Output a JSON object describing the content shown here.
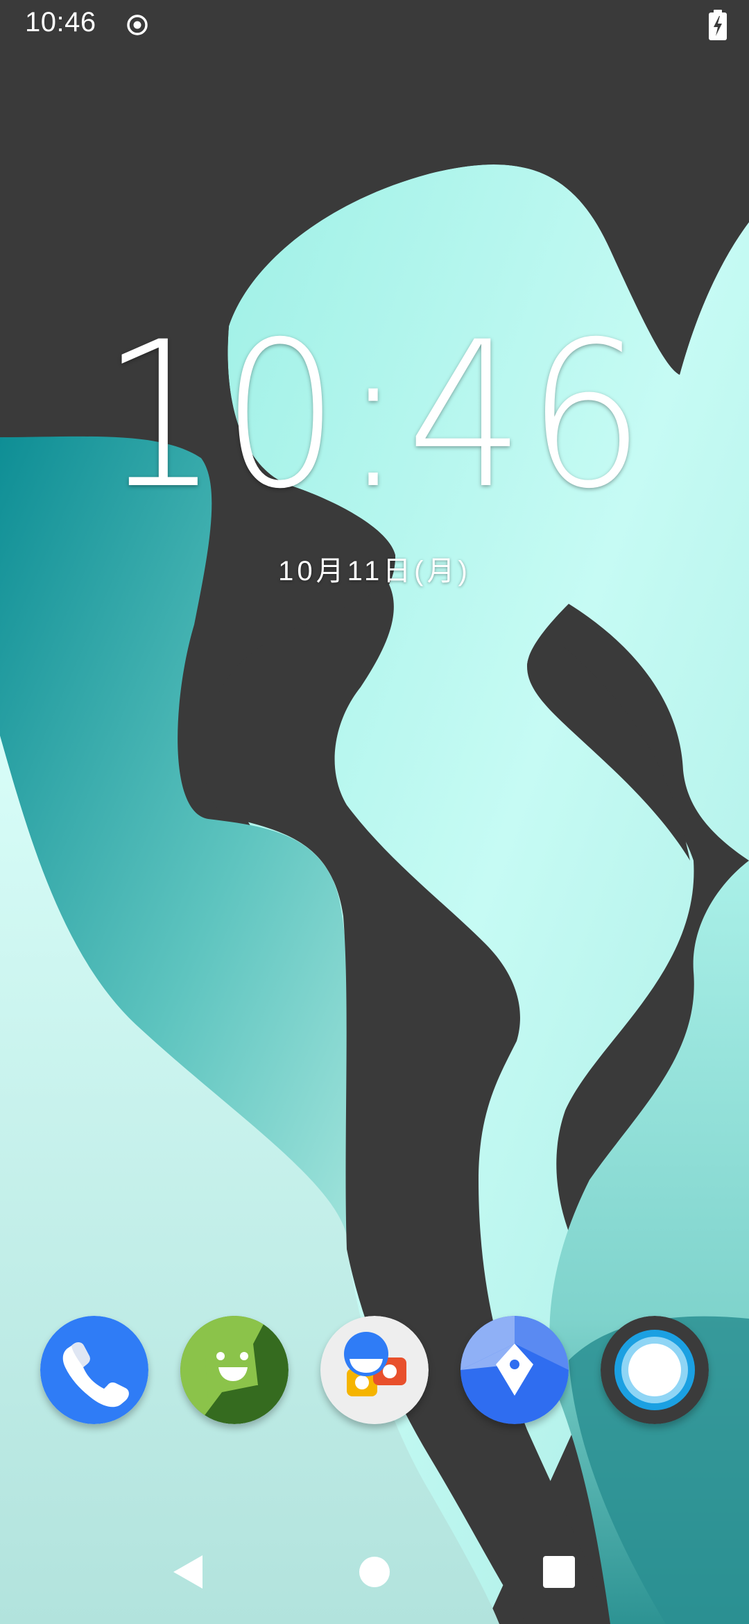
{
  "status_bar": {
    "time": "10:46",
    "left_icons": [
      "target-icon"
    ],
    "right_icons": [
      "battery-charging-icon"
    ]
  },
  "lockscreen": {
    "clock": "10:46",
    "date": "10月11日(月)"
  },
  "dock": {
    "apps": [
      {
        "name": "phone",
        "icon": "phone-icon",
        "color": "#2f7cf6"
      },
      {
        "name": "messaging",
        "icon": "message-smiley-icon",
        "color": "#8bc34a"
      },
      {
        "name": "contacts",
        "icon": "contacts-icon",
        "color": "#eeeeee"
      },
      {
        "name": "maps",
        "icon": "navigation-icon",
        "color": "#2f6df0"
      },
      {
        "name": "camera",
        "icon": "camera-icon",
        "color": "#3b3b3b"
      }
    ]
  },
  "navigation_bar": {
    "buttons": [
      "back-icon",
      "home-icon",
      "recents-icon"
    ]
  },
  "colors": {
    "wallpaper_dark": "#3a3a3a",
    "wallpaper_mint": "#b9f3ec",
    "wallpaper_teal": "#1a9a9a",
    "text": "#ffffff"
  }
}
